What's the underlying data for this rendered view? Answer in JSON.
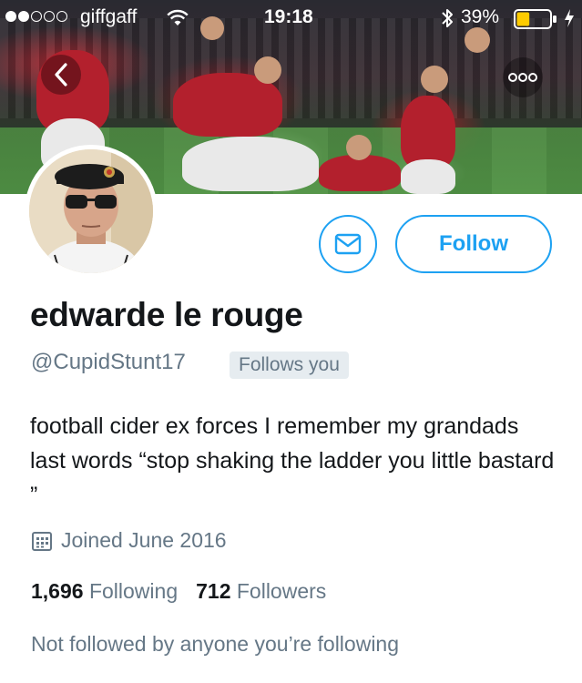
{
  "status_bar": {
    "carrier": "giffgaff",
    "time": "19:18",
    "battery_percent": "39%",
    "battery_level": 0.39,
    "signal_bars_filled": 2,
    "signal_bars_total": 5
  },
  "header": {
    "back_icon": "chevron-left-icon",
    "more_icon": "more-dots-icon"
  },
  "profile": {
    "display_name": "edwarde le rouge",
    "handle": "@CupidStunt17",
    "follows_you_label": "Follows you",
    "bio": "football cider ex forces I remember my grandads last words “stop shaking the ladder you little bastard ”",
    "joined": "Joined June 2016",
    "following_count": "1,696",
    "following_label": "Following",
    "followers_count": "712",
    "followers_label": "Followers",
    "not_followed_text": "Not followed by anyone you’re following"
  },
  "actions": {
    "message_icon": "envelope-icon",
    "follow_label": "Follow"
  },
  "colors": {
    "accent": "#1da1f2",
    "text_primary": "#14171a",
    "text_secondary": "#657786",
    "badge_bg": "#e6ecf0",
    "battery_fill": "#ffcc00"
  }
}
